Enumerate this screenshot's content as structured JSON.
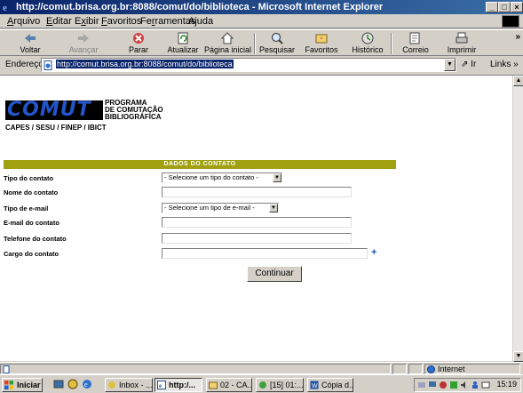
{
  "window": {
    "title": "http://comut.brisa.org.br:8088/comut/do/biblioteca - Microsoft Internet Explorer"
  },
  "menu": {
    "items": [
      "Arquivo",
      "Editar",
      "Exibir",
      "Favoritos",
      "Ferramentas",
      "Ajuda"
    ]
  },
  "toolbar": {
    "back": "Voltar",
    "forward": "Avançar",
    "stop": "Parar",
    "refresh": "Atualizar",
    "home": "Página inicial",
    "search": "Pesquisar",
    "favorites": "Favoritos",
    "history": "Histórico",
    "mail": "Correio",
    "print": "Imprimir",
    "more": "»"
  },
  "address": {
    "label": "Endereço",
    "url": "http://comut.brisa.org.br:8088/comut/do/biblioteca",
    "go": "Ir",
    "links": "Links »"
  },
  "page": {
    "logo_text": "COMUT",
    "logo_line1": "PROGRAMA",
    "logo_line2": "DE COMUTAÇÃO",
    "logo_line3": "BIBLIOGRÁFICA",
    "sponsors": "CAPES / SESU / FINEP / IBICT",
    "section_header": "DADOS DO CONTATO",
    "fields": [
      {
        "label": "Tipo do contato",
        "type": "select",
        "value": "- Selecione um tipo do contato -"
      },
      {
        "label": "Nome do contato",
        "type": "text",
        "value": ""
      },
      {
        "label": "Tipo de e-mail",
        "type": "select",
        "value": "- Selecione um tipo de e-mail -"
      },
      {
        "label": "E-mail do contato",
        "type": "text",
        "value": ""
      },
      {
        "label": "Telefone do contato",
        "type": "text",
        "value": ""
      },
      {
        "label": "Cargo do contato",
        "type": "text",
        "value": ""
      }
    ],
    "add_symbol": "+",
    "submit": "Continuar"
  },
  "status": {
    "zone": "Internet"
  },
  "taskbar": {
    "start": "Iniciar",
    "items": [
      "Inbox - ...",
      "http:/...",
      "02 - CA...",
      "[15] 01:...",
      "Cópia d..."
    ],
    "clock": "15:19"
  },
  "colors": {
    "titlebar": "#0a246a",
    "section_header": "#a0a010",
    "logo_blue": "#2255cc",
    "plus_blue": "#1f4fb0"
  }
}
